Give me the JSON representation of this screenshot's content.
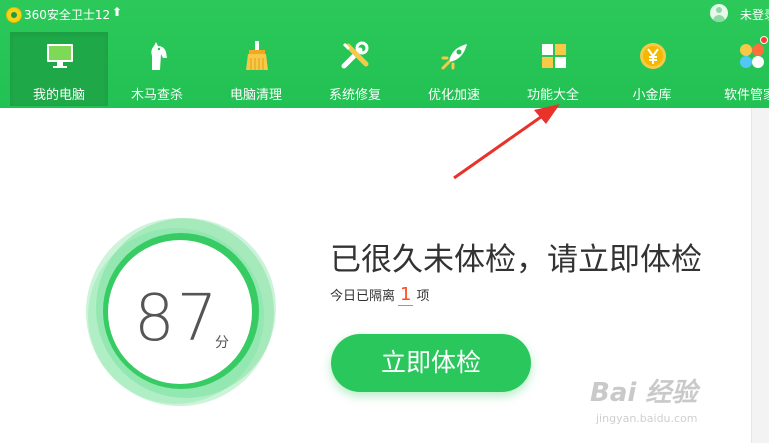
{
  "titlebar": {
    "app_title": "360安全卫士12",
    "upgrade_glyph": "⬆",
    "login_text": "未登录"
  },
  "nav": {
    "items": [
      {
        "label": "我的电脑",
        "icon": "monitor-icon",
        "active": true
      },
      {
        "label": "木马查杀",
        "icon": "horse-icon"
      },
      {
        "label": "电脑清理",
        "icon": "broom-icon"
      },
      {
        "label": "系统修复",
        "icon": "tools-icon"
      },
      {
        "label": "优化加速",
        "icon": "rocket-icon"
      },
      {
        "label": "功能大全",
        "icon": "grid-icon"
      },
      {
        "label": "小金库",
        "icon": "yen-coin-icon"
      },
      {
        "label": "软件管家",
        "icon": "apps-icon"
      }
    ]
  },
  "score": {
    "value": "87",
    "unit": "分"
  },
  "main": {
    "headline": "已很久未体检，请立即体检",
    "quarantine_prefix": "今日已隔离",
    "quarantine_count": "1",
    "quarantine_suffix": "项",
    "check_button": "立即体检"
  },
  "watermark": {
    "brand": "Bai 经验",
    "url": "jingyan.baidu.com"
  },
  "colors": {
    "brand_green": "#22c153",
    "active_tab": "#1ea847",
    "button_green": "#2ac85c",
    "arrow_red": "#e8322a",
    "count_orange": "#ff4d1f"
  }
}
